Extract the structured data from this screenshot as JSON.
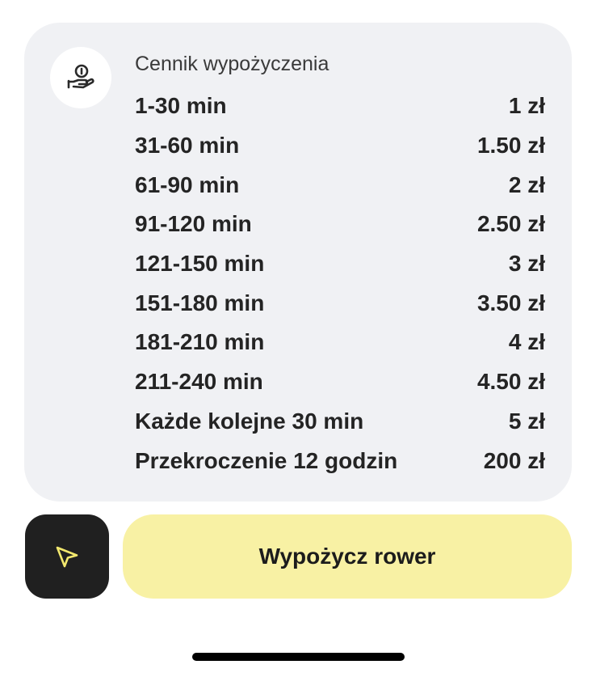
{
  "price_card": {
    "title": "Cennik wypożyczenia",
    "icon": "hand-coin-icon",
    "rows": [
      {
        "duration": "1-30 min",
        "price": "1 zł"
      },
      {
        "duration": "31-60 min",
        "price": "1.50 zł"
      },
      {
        "duration": "61-90 min",
        "price": "2 zł"
      },
      {
        "duration": "91-120 min",
        "price": "2.50 zł"
      },
      {
        "duration": "121-150 min",
        "price": "3 zł"
      },
      {
        "duration": "151-180 min",
        "price": "3.50 zł"
      },
      {
        "duration": "181-210 min",
        "price": "4 zł"
      },
      {
        "duration": "211-240 min",
        "price": "4.50 zł"
      },
      {
        "duration": "Każde kolejne 30 min",
        "price": "5 zł"
      },
      {
        "duration": "Przekroczenie 12 godzin",
        "price": "200 zł"
      }
    ]
  },
  "actions": {
    "navigate_icon": "navigation-arrow-icon",
    "rent_label": "Wypożycz rower"
  },
  "colors": {
    "card_background": "#f0f1f4",
    "primary_button": "#f8f1a4",
    "dark_button": "#202020",
    "accent_yellow": "#f2e86e"
  }
}
